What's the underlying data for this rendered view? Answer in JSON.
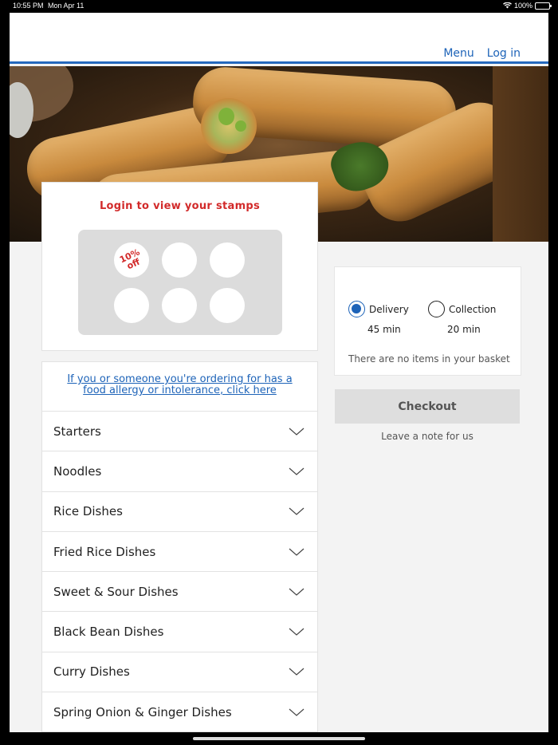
{
  "status_bar": {
    "time": "10:55 PM",
    "date": "Mon Apr 11",
    "battery": "100%"
  },
  "nav": {
    "menu": "Menu",
    "login": "Log in"
  },
  "stamps": {
    "title": "Login to view your stamps",
    "first_stamp_line1": "10%",
    "first_stamp_line2": "off",
    "total_slots": 6
  },
  "allergy_link": "If you or someone you're ordering for has a food allergy or intolerance, click here",
  "categories": [
    "Starters",
    "Noodles",
    "Rice Dishes",
    "Fried Rice Dishes",
    "Sweet & Sour Dishes",
    "Black Bean Dishes",
    "Curry Dishes",
    "Spring Onion & Ginger Dishes"
  ],
  "basket": {
    "delivery_label": "Delivery",
    "delivery_time": "45 min",
    "collection_label": "Collection",
    "collection_time": "20 min",
    "selected": "delivery",
    "empty_text": "There are no items in your basket"
  },
  "checkout_label": "Checkout",
  "note_label": "Leave a note for us",
  "colors": {
    "accent_blue": "#1d63b8",
    "stamp_red": "#d22a2a"
  }
}
